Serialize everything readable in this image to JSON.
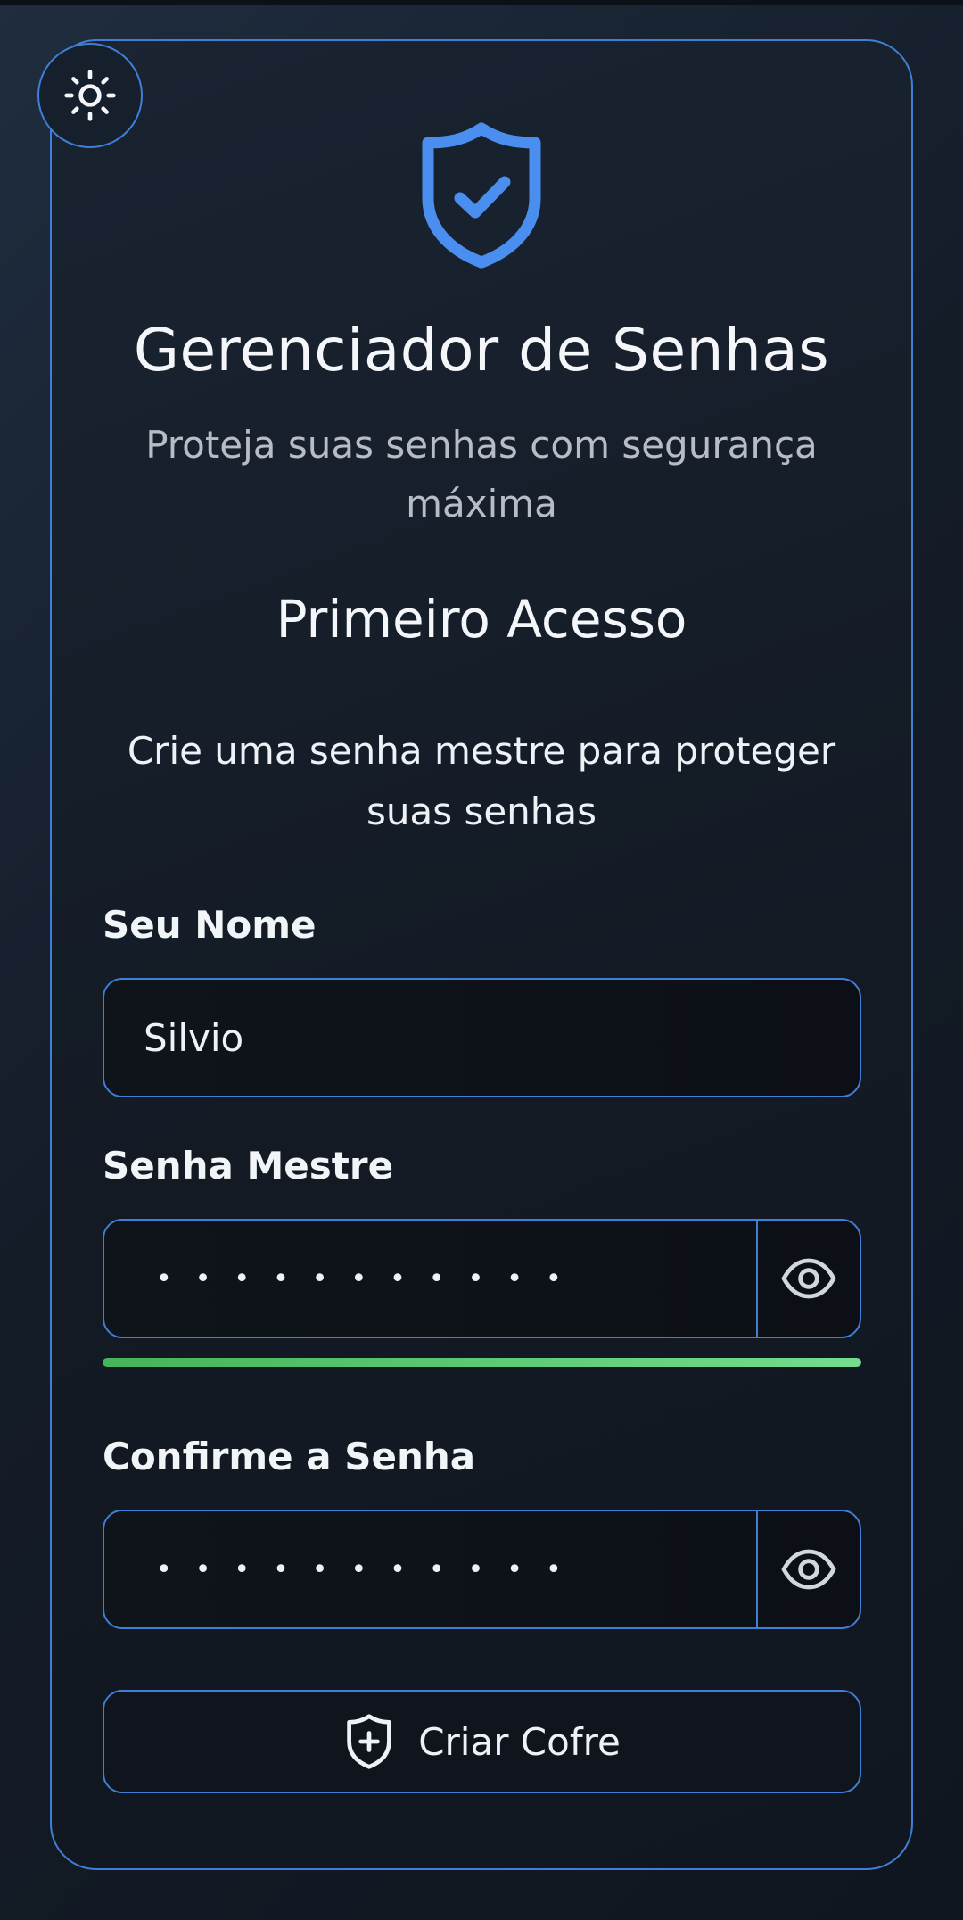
{
  "app": {
    "title": "Gerenciador de Senhas",
    "subtitle": "Proteja suas senhas com segurança máxima"
  },
  "form": {
    "heading": "Primeiro Acesso",
    "instructions": "Crie uma senha mestre para proteger suas senhas",
    "name": {
      "label": "Seu Nome",
      "value": "Silvio"
    },
    "master_password": {
      "label": "Senha Mestre",
      "masked_value": "•••••••••••",
      "strength": 1.0
    },
    "confirm_password": {
      "label": "Confirme a Senha",
      "masked_value": "•••••••••••"
    },
    "submit_label": "Criar Cofre"
  },
  "icons": {
    "theme_toggle": "sun-icon",
    "logo": "shield-check-icon",
    "toggle_visibility": "eye-icon",
    "submit": "shield-plus-icon"
  },
  "colors": {
    "accent": "#3f7fd6",
    "logo": "#4a8ff0",
    "strength_strong": "#5fce77"
  }
}
